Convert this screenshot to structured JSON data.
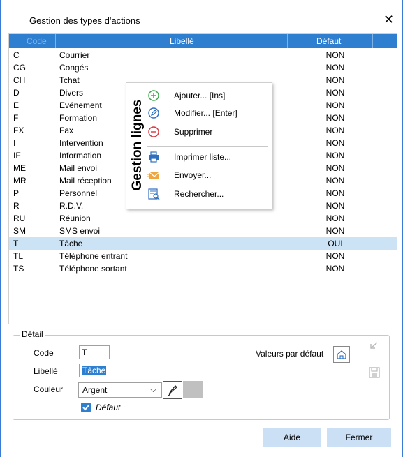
{
  "window": {
    "title": "Gestion des types d'actions",
    "close_glyph": "✕"
  },
  "grid": {
    "headers": {
      "code": "Code",
      "libelle": "Libellé",
      "defaut": "Défaut"
    },
    "rows": [
      {
        "code": "C",
        "libelle": "Courrier",
        "defaut": "NON"
      },
      {
        "code": "CG",
        "libelle": "Congés",
        "defaut": "NON"
      },
      {
        "code": "CH",
        "libelle": "Tchat",
        "defaut": "NON"
      },
      {
        "code": "D",
        "libelle": "Divers",
        "defaut": "NON"
      },
      {
        "code": "E",
        "libelle": "Evénement",
        "defaut": "NON"
      },
      {
        "code": "F",
        "libelle": "Formation",
        "defaut": "NON"
      },
      {
        "code": "FX",
        "libelle": "Fax",
        "defaut": "NON"
      },
      {
        "code": "I",
        "libelle": "Intervention",
        "defaut": "NON"
      },
      {
        "code": "IF",
        "libelle": "Information",
        "defaut": "NON"
      },
      {
        "code": "ME",
        "libelle": "Mail envoi",
        "defaut": "NON"
      },
      {
        "code": "MR",
        "libelle": "Mail réception",
        "defaut": "NON"
      },
      {
        "code": "P",
        "libelle": "Personnel",
        "defaut": "NON"
      },
      {
        "code": "R",
        "libelle": "R.D.V.",
        "defaut": "NON"
      },
      {
        "code": "RU",
        "libelle": "Réunion",
        "defaut": "NON"
      },
      {
        "code": "SM",
        "libelle": "SMS envoi",
        "defaut": "NON"
      },
      {
        "code": "T",
        "libelle": "Tâche",
        "defaut": "OUI"
      },
      {
        "code": "TL",
        "libelle": "Téléphone entrant",
        "defaut": "NON"
      },
      {
        "code": "TS",
        "libelle": "Téléphone sortant",
        "defaut": "NON"
      }
    ],
    "selected_index": 15
  },
  "context_menu": {
    "side_title": "Gestion lignes",
    "items": [
      {
        "label": "Ajouter... [Ins]",
        "icon": "add-circle-icon"
      },
      {
        "label": "Modifier... [Enter]",
        "icon": "edit-pencil-icon"
      },
      {
        "label": "Supprimer",
        "icon": "remove-circle-icon"
      },
      {
        "label": "Imprimer liste...",
        "icon": "printer-icon"
      },
      {
        "label": "Envoyer...",
        "icon": "envelope-icon"
      },
      {
        "label": "Rechercher...",
        "icon": "search-list-icon"
      }
    ]
  },
  "detail": {
    "legend": "Détail",
    "code_label": "Code",
    "code_value": "T",
    "libelle_label": "Libellé",
    "libelle_value": "Tâche",
    "couleur_label": "Couleur",
    "couleur_value": "Argent",
    "defaut_label": "Défaut",
    "defaut_checked": true,
    "valeurs_label": "Valeurs par défaut"
  },
  "buttons": {
    "aide": "Aide",
    "fermer": "Fermer"
  },
  "colors": {
    "accent": "#2f7fd1",
    "selection": "#cce3f6",
    "swatch": "#c0c0c0"
  }
}
